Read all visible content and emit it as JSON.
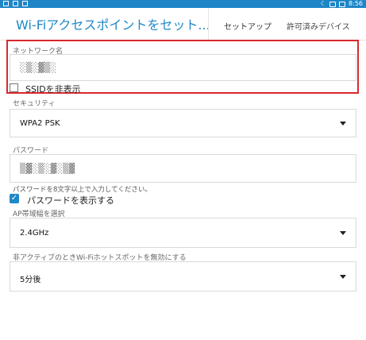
{
  "status_bar": {
    "time": "8:56"
  },
  "header": {
    "title": "Wi-Fiアクセスポイントをセット...",
    "tabs": [
      {
        "label": "セットアップ",
        "active": true
      },
      {
        "label": "許可済みデバイス",
        "active": false
      }
    ]
  },
  "network_name": {
    "label": "ネットワーク名",
    "value": "░▒░▓▒░"
  },
  "hide_ssid": {
    "label": "SSIDを非表示",
    "checked": false
  },
  "security": {
    "label": "セキュリティ",
    "value": "WPA2 PSK"
  },
  "password": {
    "label": "パスワード",
    "value": "▒▓░▒░▓░▒▓",
    "hint": "パスワードを8文字以上で入力してください。"
  },
  "show_password": {
    "label": "パスワードを表示する",
    "checked": true
  },
  "ap_band": {
    "label": "AP帯域幅を選択",
    "value": "2.4GHz"
  },
  "inactive_hotspot": {
    "label": "非アクティブのときWi-Fiホットスポットを無効にする",
    "value": "5分後"
  },
  "colors": {
    "accent": "#1e88c8",
    "highlight": "#d9272e",
    "status_bar": "#1e86c7"
  },
  "icons": [
    "checkbox-icon",
    "dropdown-arrow-icon",
    "wifi-icon",
    "battery-icon",
    "moon-icon"
  ]
}
